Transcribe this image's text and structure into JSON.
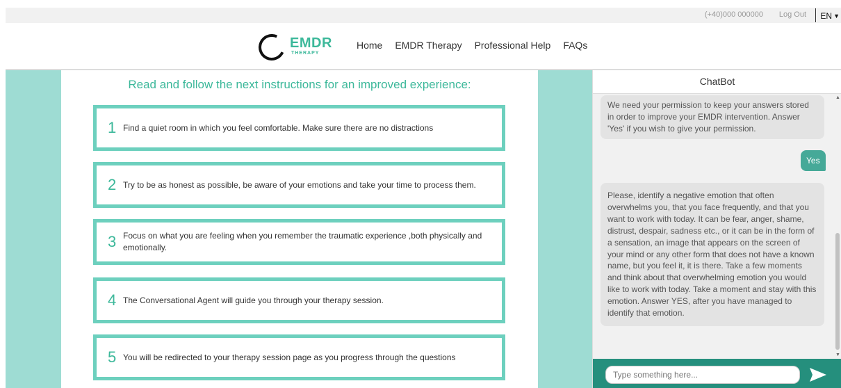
{
  "topbar": {
    "phone": "(+40)000 000000",
    "logout": "Log Out",
    "language": "EN"
  },
  "logo": {
    "brand": "EMDR",
    "sub": "THERAPY"
  },
  "nav": [
    "Home",
    "EMDR Therapy",
    "Professional Help",
    "FAQs"
  ],
  "instructions": {
    "heading": "Read and follow the next instructions for an improved experience:",
    "items": [
      {
        "num": "1",
        "text": "Find a quiet room in which you feel comfortable. Make sure there are no distractions"
      },
      {
        "num": "2",
        "text": "Try to be as honest as possible, be aware of your emotions and take your time to process them."
      },
      {
        "num": "3",
        "text": "Focus on what you are feeling when you remember the traumatic experience ,both physically and emotionally."
      },
      {
        "num": "4",
        "text": "The Conversational Agent will guide you through your therapy session."
      },
      {
        "num": "5",
        "text": "You will be redirected to your therapy session page as you progress through the questions"
      }
    ]
  },
  "chat": {
    "title": "ChatBot",
    "messages": [
      {
        "from": "bot",
        "text": "We need your permission to keep your answers stored in order to improve your EMDR intervention. Answer 'Yes' if you wish to give your permission."
      },
      {
        "from": "user",
        "text": "Yes"
      },
      {
        "from": "bot",
        "text": "Please, identify a negative emotion that often overwhelms you, that you face frequently, and that you want to work with today. It can be fear, anger, shame, distrust, despair, sadness etc., or it can be in the form of a sensation, an image that appears on the screen of your mind or any other form that does not have a known name, but you feel it, it is there. Take a few moments and think about that overwhelming emotion you would like to work with today. Take a moment and stay with this emotion. Answer YES, after you have managed to identify that emotion."
      }
    ],
    "input_placeholder": "Type something here...",
    "send_icon": "send-arrow-icon"
  },
  "colors": {
    "accent": "#3cb89a",
    "panel": "#9edcd3",
    "card_border": "#6dd0be",
    "chat_footer": "#258f7d",
    "user_bubble": "#46a998"
  }
}
